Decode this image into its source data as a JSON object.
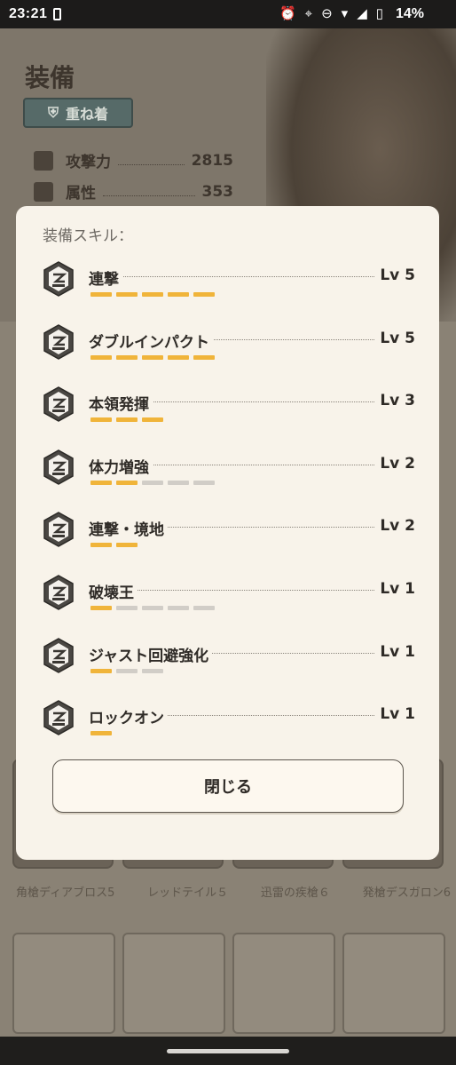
{
  "status_bar": {
    "time": "23:21",
    "battery_percent": "14%",
    "icons": [
      "alarm-icon",
      "location-icon",
      "dnd-icon",
      "wifi-icon",
      "signal-icon",
      "battery-icon"
    ]
  },
  "background": {
    "title": "装備",
    "layer_button": "重ね着",
    "stats": [
      {
        "label": "攻撃力",
        "value": "2815"
      },
      {
        "label": "属性",
        "value": "353"
      }
    ],
    "card_names": [
      "角槍ディアブロス5",
      "レッドテイル５",
      "迅雷の疾槍６",
      "発槍デスガロン6"
    ]
  },
  "modal": {
    "heading": "装備スキル：",
    "skills": [
      {
        "name": "連撃",
        "level": "Lv 5",
        "filled": 5,
        "total": 5
      },
      {
        "name": "ダブルインパクト",
        "level": "Lv 5",
        "filled": 5,
        "total": 5
      },
      {
        "name": "本領発揮",
        "level": "Lv 3",
        "filled": 3,
        "total": 3
      },
      {
        "name": "体力増強",
        "level": "Lv 2",
        "filled": 2,
        "total": 5
      },
      {
        "name": "連撃・境地",
        "level": "Lv 2",
        "filled": 2,
        "total": 2
      },
      {
        "name": "破壊王",
        "level": "Lv 1",
        "filled": 1,
        "total": 5
      },
      {
        "name": "ジャスト回避強化",
        "level": "Lv 1",
        "filled": 1,
        "total": 3
      },
      {
        "name": "ロックオン",
        "level": "Lv 1",
        "filled": 1,
        "total": 1
      }
    ],
    "close_label": "閉じる"
  },
  "colors": {
    "pip_on": "#f0b43a",
    "pip_off": "#d1cdc7",
    "modal_bg": "#f8f3ea"
  }
}
